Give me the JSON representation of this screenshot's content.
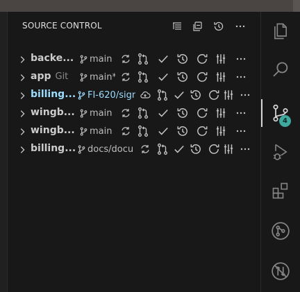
{
  "panel": {
    "title": "SOURCE CONTROL"
  },
  "header_icons": [
    "view-as-tree-icon",
    "collapse-all-icon",
    "history-icon",
    "more-actions-icon"
  ],
  "repositories": [
    {
      "name": "backe...",
      "sub": "",
      "branch": "main",
      "active": false
    },
    {
      "name": "app",
      "sub": "Git",
      "branch": "main*",
      "active": false
    },
    {
      "name": "billing...",
      "sub": "",
      "branch": "FI-620/sign",
      "active": true
    },
    {
      "name": "wingb...",
      "sub": "",
      "branch": "main",
      "active": false
    },
    {
      "name": "wingb...",
      "sub": "",
      "branch": "main",
      "active": false
    },
    {
      "name": "billing...",
      "sub": "",
      "branch": "docs/docu",
      "active": false
    }
  ],
  "activity_bar": {
    "items": [
      "explorer-icon",
      "search-icon",
      "source-control-icon",
      "run-debug-icon",
      "extensions-icon",
      "remote-icon",
      "no-sync-icon"
    ],
    "selected": "source-control-icon",
    "source_control_badge": "4"
  },
  "colors": {
    "accent": "#9cdcfe",
    "badge": "#3fa99f",
    "background": "#181818"
  }
}
